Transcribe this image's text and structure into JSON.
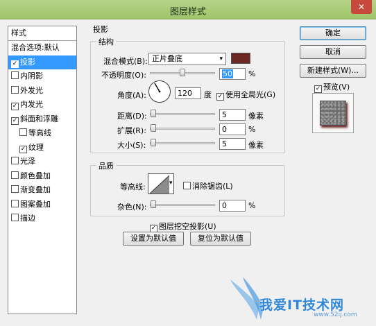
{
  "window": {
    "title": "图层样式",
    "close_glyph": "✕"
  },
  "style_list": {
    "header": "样式",
    "items": [
      {
        "label": "混合选项:默认",
        "checkbox": false,
        "checked": false,
        "indent": false,
        "selected": false
      },
      {
        "label": "投影",
        "checkbox": true,
        "checked": true,
        "indent": false,
        "selected": true
      },
      {
        "label": "内阴影",
        "checkbox": true,
        "checked": false,
        "indent": false,
        "selected": false
      },
      {
        "label": "外发光",
        "checkbox": true,
        "checked": false,
        "indent": false,
        "selected": false
      },
      {
        "label": "内发光",
        "checkbox": true,
        "checked": true,
        "indent": false,
        "selected": false
      },
      {
        "label": "斜面和浮雕",
        "checkbox": true,
        "checked": true,
        "indent": false,
        "selected": false
      },
      {
        "label": "等高线",
        "checkbox": true,
        "checked": false,
        "indent": true,
        "selected": false
      },
      {
        "label": "纹理",
        "checkbox": true,
        "checked": true,
        "indent": true,
        "selected": false
      },
      {
        "label": "光泽",
        "checkbox": true,
        "checked": false,
        "indent": false,
        "selected": false
      },
      {
        "label": "颜色叠加",
        "checkbox": true,
        "checked": false,
        "indent": false,
        "selected": false
      },
      {
        "label": "渐变叠加",
        "checkbox": true,
        "checked": false,
        "indent": false,
        "selected": false
      },
      {
        "label": "图案叠加",
        "checkbox": true,
        "checked": false,
        "indent": false,
        "selected": false
      },
      {
        "label": "描边",
        "checkbox": true,
        "checked": false,
        "indent": false,
        "selected": false
      }
    ]
  },
  "drop_shadow": {
    "legend": "投影",
    "structure": {
      "legend": "结构",
      "blend_mode_label": "混合模式(B):",
      "blend_mode_value": "正片叠底",
      "shadow_color": "#6b2722",
      "opacity_label": "不透明度(O):",
      "opacity_value": "50",
      "opacity_unit": "%",
      "opacity_fraction": 0.5,
      "angle_label": "角度(A):",
      "angle_value": "120",
      "angle_unit": "度",
      "global_light_label": "使用全局光(G)",
      "global_light_checked": true,
      "distance_label": "距离(D):",
      "distance_value": "5",
      "distance_unit": "像素",
      "spread_label": "扩展(R):",
      "spread_value": "0",
      "spread_unit": "%",
      "size_label": "大小(S):",
      "size_value": "5",
      "size_unit": "像素"
    },
    "quality": {
      "legend": "品质",
      "contour_label": "等高线:",
      "anti_alias_label": "消除锯齿(L)",
      "anti_alias_checked": false,
      "noise_label": "杂色(N):",
      "noise_value": "0",
      "noise_unit": "%"
    },
    "knockout_label": "图层挖空投影(U)",
    "knockout_checked": true,
    "make_default_label": "设置为默认值",
    "reset_default_label": "复位为默认值"
  },
  "buttons": {
    "ok": "确定",
    "cancel": "取消",
    "new_style": "新建样式(W)...",
    "preview_label": "预览(V)",
    "preview_checked": true
  },
  "watermark": {
    "text": "我爱IT技术网",
    "url": "www.52ij.com"
  },
  "glyphs": {
    "check": "✓",
    "dropdown": "▾"
  }
}
